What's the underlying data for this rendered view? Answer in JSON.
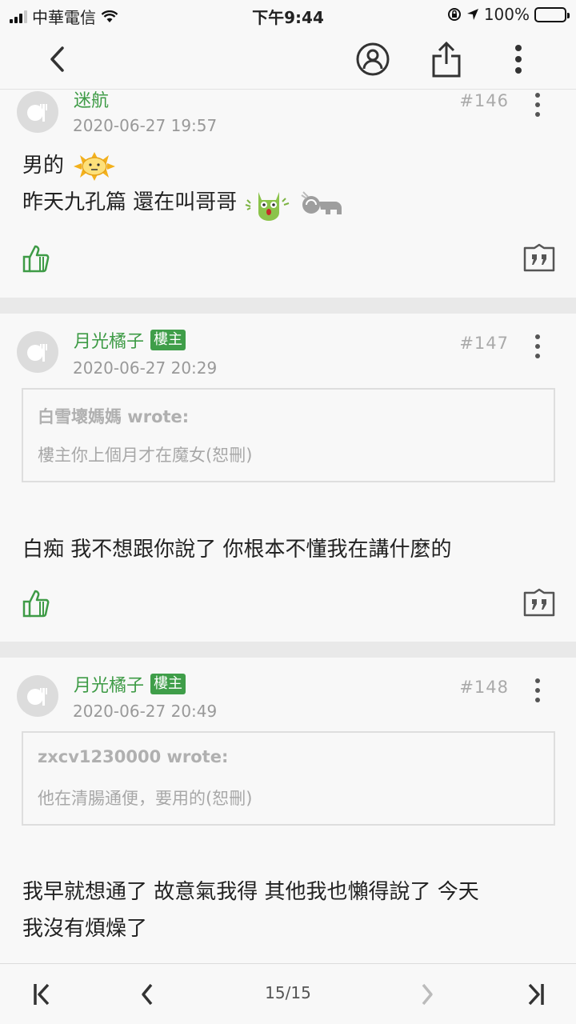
{
  "status_bar": {
    "carrier": "中華電信",
    "time": "下午9:44",
    "battery_text": "100%",
    "battery_level": 1.0
  },
  "nav": {
    "icons": [
      "back-chevron-icon",
      "user-circle-icon",
      "share-icon",
      "more-vertical-icon"
    ]
  },
  "posts": [
    {
      "username": "迷航",
      "is_op": false,
      "timestamp": "2020-06-27 19:57",
      "floor": "#146",
      "lines": [
        "男的",
        "昨天九孔篇 還在叫哥哥"
      ]
    },
    {
      "username": "月光橘子",
      "is_op": true,
      "op_label": "樓主",
      "timestamp": "2020-06-27 20:29",
      "floor": "#147",
      "quote": {
        "author": "白雪壞媽媽 wrote:",
        "text": "樓主你上個月才在魔女(恕刪)"
      },
      "lines": [
        "白痴 我不想跟你說了 你根本不懂我在講什麼的"
      ]
    },
    {
      "username": "月光橘子",
      "is_op": true,
      "op_label": "樓主",
      "timestamp": "2020-06-27 20:49",
      "floor": "#148",
      "quote": {
        "author": "zxcv1230000 wrote:",
        "text": "他在清腸通便，要用的(恕刪)"
      },
      "lines": [
        "我早就想通了 故意氣我得 其他我也懶得說了 今天",
        "我沒有煩燥了"
      ]
    }
  ],
  "pagination": {
    "current_page": 15,
    "total_pages": 15,
    "label": "15/15"
  },
  "colors": {
    "accent_green": "#3e9b46",
    "background": "#f8f8f8",
    "separator": "#e9e9e9"
  }
}
